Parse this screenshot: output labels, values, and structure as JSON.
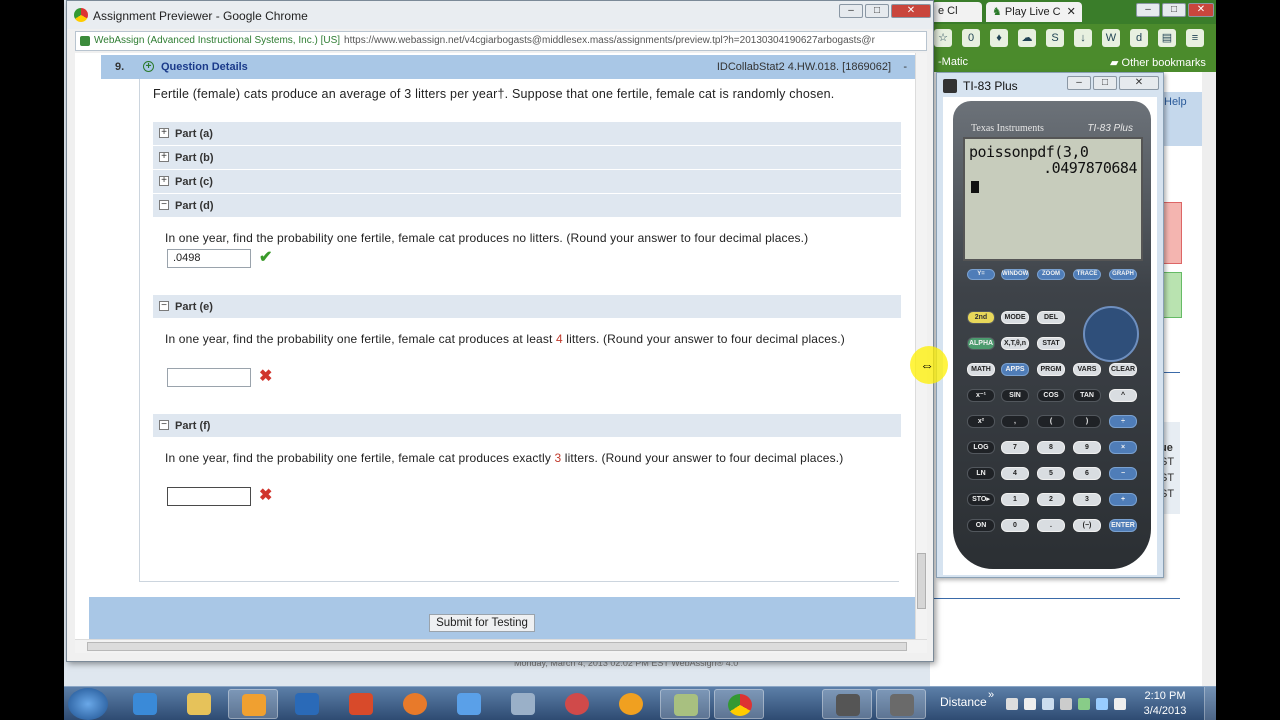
{
  "background_window": {
    "tabs": [
      {
        "label": "e Cl"
      },
      {
        "label": "Play Live C"
      }
    ],
    "bookmarks_label": "Other bookmarks",
    "bookmark_left": "-Matic",
    "help_label": "Help",
    "list_items": [
      "ue",
      "ST",
      "ST",
      "ST"
    ],
    "footer_text": "Monday, March 4, 2013 02:02 PM EST WebAssign® 4.0"
  },
  "popup": {
    "title": "Assignment Previewer - Google Chrome",
    "url_org": "WebAssign (Advanced Instructional Systems, Inc.) [US]",
    "url": "https://www.webassign.net/v4cgiarbogasts@middlesex.mass/assignments/preview.tpl?h=20130304190627arbogasts@r",
    "window_controls": {
      "minimize": "–",
      "maximize": "□",
      "close": "✕"
    }
  },
  "question": {
    "number": "9.",
    "details_label": "Question Details",
    "id": "IDCollabStat2 4.HW.018. [1869062]",
    "collapse_symbol": "-",
    "prompt": "Fertile (female) cats produce an average of 3 litters per year†. Suppose that one fertile, female cat is randomly chosen.",
    "parts": [
      {
        "label": "Part (a)",
        "toggle": "+"
      },
      {
        "label": "Part (b)",
        "toggle": "+"
      },
      {
        "label": "Part (c)",
        "toggle": "+"
      },
      {
        "label": "Part (d)",
        "toggle": "−",
        "text": "In one year, find the probability one fertile, female cat produces no litters. (Round your answer to four decimal places.)",
        "answer": ".0498",
        "status": "✔"
      },
      {
        "label": "Part (e)",
        "toggle": "−",
        "text_pre": "In one year, find the probability one fertile, female cat produces at least ",
        "number": "4",
        "text_post": " litters. (Round your answer to four decimal places.)",
        "answer": "",
        "status": "✖"
      },
      {
        "label": "Part (f)",
        "toggle": "−",
        "text_pre": "In one year, find the probability one fertile, female cat produces exactly ",
        "number": "3",
        "text_post": " litters. (Round your answer to four decimal places.)",
        "answer": "",
        "status": "✖"
      }
    ],
    "submit_label": "Submit for Testing"
  },
  "calculator": {
    "window_title": "TI-83 Plus",
    "brand": "Texas Instruments",
    "model": "TI-83 Plus",
    "screen_line1": "poissonpdf(3,0",
    "screen_line2": ".0497870684",
    "keys": {
      "row_fn": [
        "Y=",
        "WINDOW",
        "ZOOM",
        "TRACE",
        "GRAPH"
      ],
      "row1": [
        "2nd",
        "MODE",
        "DEL"
      ],
      "row2": [
        "ALPHA",
        "X,T,θ,n",
        "STAT"
      ],
      "row3": [
        "MATH",
        "APPS",
        "PRGM",
        "VARS",
        "CLEAR"
      ],
      "row4": [
        "x⁻¹",
        "SIN",
        "COS",
        "TAN",
        "^"
      ],
      "row5": [
        "x²",
        ",",
        "(",
        ")",
        "÷"
      ],
      "row6": [
        "LOG",
        "7",
        "8",
        "9",
        "×"
      ],
      "row7": [
        "LN",
        "4",
        "5",
        "6",
        "−"
      ],
      "row8": [
        "STO▸",
        "1",
        "2",
        "3",
        "+"
      ],
      "row9": [
        "ON",
        "0",
        ".",
        "(−)",
        "ENTER"
      ]
    }
  },
  "taskbar": {
    "toolbar_label": "Distance",
    "time": "2:10 PM",
    "date": "3/4/2013",
    "chevron": "»"
  },
  "colors": {
    "header_blue": "#a9c7e6",
    "part_bar": "#dfe7f0",
    "correct_green": "#3a9a2a",
    "wrong_red": "#d0342c",
    "number_red": "#c0392b"
  }
}
